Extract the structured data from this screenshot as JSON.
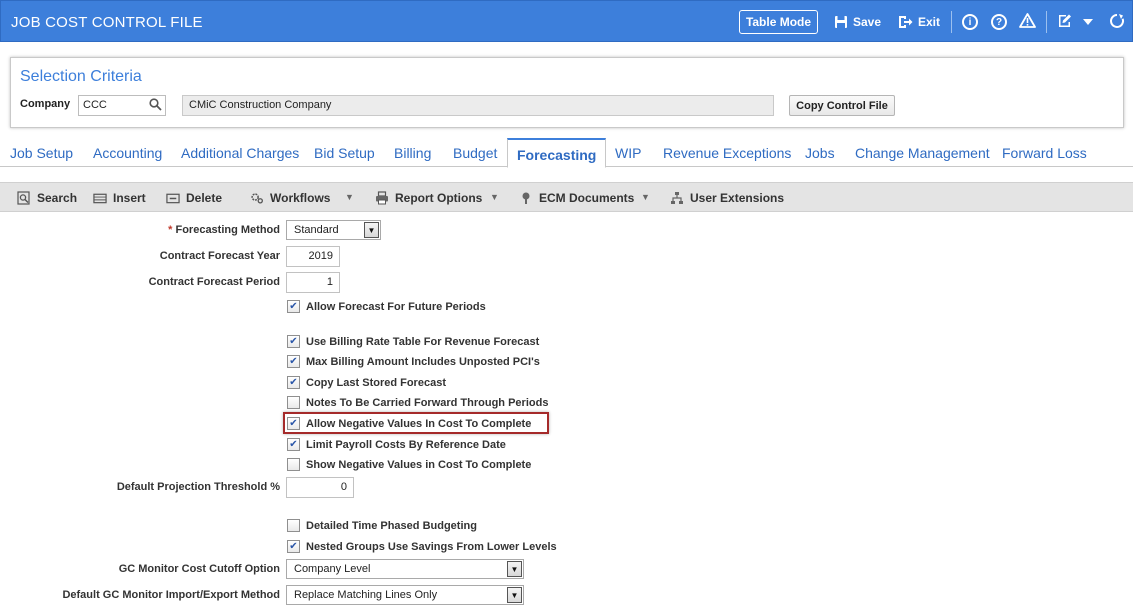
{
  "app": {
    "title": "JOB COST CONTROL FILE"
  },
  "header": {
    "table_mode": "Table Mode",
    "save": "Save",
    "exit": "Exit"
  },
  "selection": {
    "title": "Selection Criteria",
    "company_label": "Company",
    "company_value": "CCC",
    "company_name": "CMiC Construction Company",
    "copy_button": "Copy Control File"
  },
  "tabs": [
    {
      "label": "Job Setup"
    },
    {
      "label": "Accounting"
    },
    {
      "label": "Additional Charges"
    },
    {
      "label": "Bid Setup"
    },
    {
      "label": "Billing"
    },
    {
      "label": "Budget"
    },
    {
      "label": "Forecasting",
      "active": true
    },
    {
      "label": "WIP"
    },
    {
      "label": "Revenue Exceptions"
    },
    {
      "label": "Jobs"
    },
    {
      "label": "Change Management"
    },
    {
      "label": "Forward Loss"
    }
  ],
  "toolbar": {
    "search": "Search",
    "insert": "Insert",
    "delete": "Delete",
    "workflows": "Workflows",
    "report_options": "Report Options",
    "ecm_documents": "ECM Documents",
    "user_extensions": "User Extensions"
  },
  "form": {
    "forecasting_method": {
      "required_mark": "*",
      "label": "Forecasting Method",
      "value": "Standard"
    },
    "contract_forecast_year": {
      "label": "Contract Forecast Year",
      "value": "2019"
    },
    "contract_forecast_period": {
      "label": "Contract Forecast Period",
      "value": "1"
    },
    "checkboxes_1": [
      {
        "label": "Allow Forecast For Future Periods",
        "checked": true
      }
    ],
    "checkboxes_2": [
      {
        "label": "Use Billing Rate Table For Revenue Forecast",
        "checked": true
      },
      {
        "label": "Max Billing Amount Includes Unposted PCI's",
        "checked": true
      },
      {
        "label": "Copy Last Stored Forecast",
        "checked": true
      },
      {
        "label": "Notes To Be Carried Forward Through Periods",
        "checked": false
      },
      {
        "label": "Allow Negative Values In Cost To Complete",
        "checked": true,
        "highlighted": true
      },
      {
        "label": "Limit Payroll Costs By Reference Date",
        "checked": true
      },
      {
        "label": "Show Negative Values in Cost To Complete",
        "checked": false
      }
    ],
    "default_projection_threshold": {
      "label": "Default Projection Threshold %",
      "value": "0"
    },
    "checkboxes_3": [
      {
        "label": "Detailed Time Phased Budgeting",
        "checked": false
      },
      {
        "label": "Nested Groups Use Savings From Lower Levels",
        "checked": true
      }
    ],
    "gc_monitor_cutoff": {
      "label": "GC Monitor Cost Cutoff Option",
      "value": "Company Level"
    },
    "gc_monitor_import_export": {
      "label": "Default GC Monitor Import/Export Method",
      "value": "Replace Matching Lines Only"
    }
  },
  "colors": {
    "header_blue": "#3d7fdb",
    "link_blue": "#2f6bc2",
    "highlight_red": "#a52a2a"
  }
}
